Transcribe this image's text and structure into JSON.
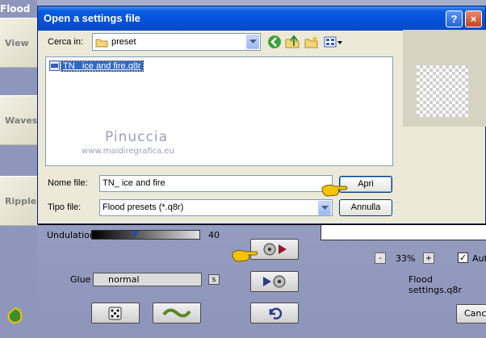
{
  "background_app": {
    "title": "Flood",
    "side_tabs": [
      "View",
      "Waves",
      "Ripple"
    ],
    "undulation": {
      "label": "Undulation",
      "value": "40",
      "level": 0.4
    },
    "glue": {
      "label": "Glue",
      "value": "normal",
      "s_button": "s"
    },
    "zoom": {
      "minus": "-",
      "value": "33%",
      "plus": "+"
    },
    "auto_checkbox": {
      "label": "Aut",
      "checked": true
    },
    "settings_file": "Flood settings.q8r",
    "cancel_label": "Cance"
  },
  "dialog": {
    "title": "Open a settings file",
    "help_button": "?",
    "close_button": "×",
    "look_in_label": "Cerca in:",
    "look_in_value": "preset",
    "files": [
      {
        "name": "TN_ ice and fire.q8r",
        "selected": true
      }
    ],
    "watermark_name": "Pinuccia",
    "watermark_url": "www.maidiregrafica.eu",
    "filename_label": "Nome file:",
    "filename_value": "TN_ ice and fire",
    "filetype_label": "Tipo file:",
    "filetype_value": "Flood presets (*.q8r)",
    "open_button": "Apri",
    "cancel_button": "Annulla"
  },
  "colors": {
    "titlebar": "#0450d8",
    "selection": "#316ac5",
    "dialog_bg": "#ece9d8",
    "app_bg": "#9aa1c4"
  }
}
